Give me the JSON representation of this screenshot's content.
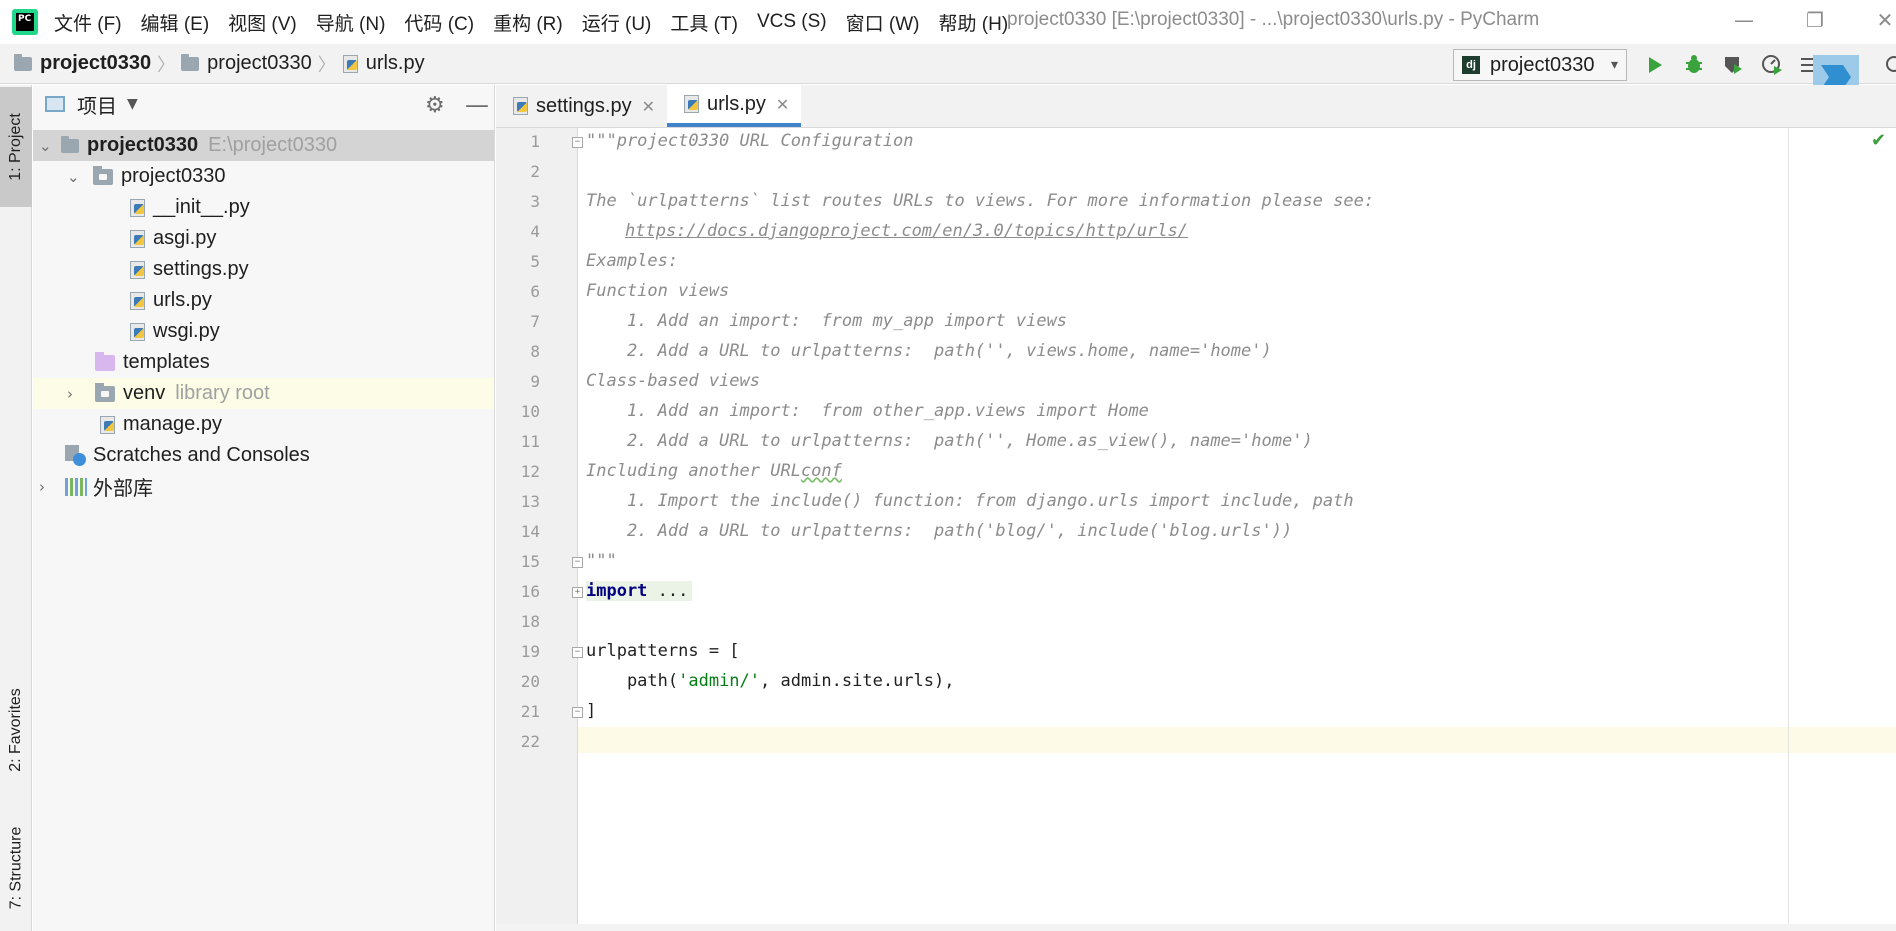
{
  "app": {
    "window_title": "project0330 [E:\\project0330] - ...\\project0330\\urls.py - PyCharm",
    "logo_text": "PC"
  },
  "menu": [
    "文件 (F)",
    "编辑 (E)",
    "视图 (V)",
    "导航 (N)",
    "代码 (C)",
    "重构 (R)",
    "运行 (U)",
    "工具 (T)",
    "VCS (S)",
    "窗口 (W)",
    "帮助 (H)"
  ],
  "window_controls": {
    "minimize": "—",
    "restore": "❐",
    "close": "✕"
  },
  "breadcrumb": [
    "project0330",
    "project0330",
    "urls.py"
  ],
  "run_config": {
    "label": "project0330",
    "icon_text": "dj"
  },
  "toolbar_icons": [
    "run-icon",
    "debug-icon",
    "coverage-icon",
    "profile-icon",
    "build-icon",
    "jetbrains-logo"
  ],
  "left_strip": {
    "project": "1: Project",
    "favorites": "2: Favorites",
    "structure": "7: Structure"
  },
  "project_panel": {
    "title": "项目",
    "tree": [
      {
        "label": "project0330",
        "hint": "E:\\project0330",
        "icon": "folder-icon",
        "expanded": true
      },
      {
        "label": "project0330",
        "icon": "package-folder-icon",
        "expanded": true
      },
      {
        "label": "__init__.py",
        "icon": "python-file-icon"
      },
      {
        "label": "asgi.py",
        "icon": "python-file-icon"
      },
      {
        "label": "settings.py",
        "icon": "python-file-icon"
      },
      {
        "label": "urls.py",
        "icon": "python-file-icon"
      },
      {
        "label": "wsgi.py",
        "icon": "python-file-icon"
      },
      {
        "label": "templates",
        "icon": "templates-folder-icon"
      },
      {
        "label": "venv",
        "hint": "library root",
        "icon": "library-folder-icon",
        "expanded": false
      },
      {
        "label": "manage.py",
        "icon": "python-file-icon"
      },
      {
        "label": "Scratches and Consoles",
        "icon": "scratches-icon"
      },
      {
        "label": "外部库",
        "icon": "external-libraries-icon",
        "expanded": false
      }
    ]
  },
  "editor_tabs": [
    {
      "label": "settings.py",
      "active": false
    },
    {
      "label": "urls.py",
      "active": true
    }
  ],
  "editor": {
    "line_numbers": [
      "1",
      "2",
      "3",
      "4",
      "5",
      "6",
      "7",
      "8",
      "9",
      "10",
      "11",
      "12",
      "13",
      "14",
      "15",
      "16",
      "18",
      "19",
      "20",
      "21",
      "22"
    ],
    "lines": {
      "l1": "\"\"\"project0330 URL Configuration",
      "l3": "The `urlpatterns` list routes URLs to views. For more information please see:",
      "l4": "https://docs.djangoproject.com/en/3.0/topics/http/urls/",
      "l5": "Examples:",
      "l6": "Function views",
      "l7": "    1. Add an import:  from my_app import views",
      "l8": "    2. Add a URL to urlpatterns:  path('', views.home, name='home')",
      "l9": "Class-based views",
      "l10": "    1. Add an import:  from other_app.views import Home",
      "l11": "    2. Add a URL to urlpatterns:  path('', Home.as_view(), name='home')",
      "l12_a": "Including another URL",
      "l12_b": "conf",
      "l13": "    1. Import the include() function: from django.urls import include, path",
      "l14": "    2. Add a URL to urlpatterns:  path('blog/', include('blog.urls'))",
      "l15": "\"\"\"",
      "l16_kw": "import",
      "l16_rest": " ...",
      "l19": "urlpatterns = [",
      "l20_a": "    path(",
      "l20_str": "'admin/'",
      "l20_b": ", admin.site.urls),",
      "l21": "]"
    }
  }
}
